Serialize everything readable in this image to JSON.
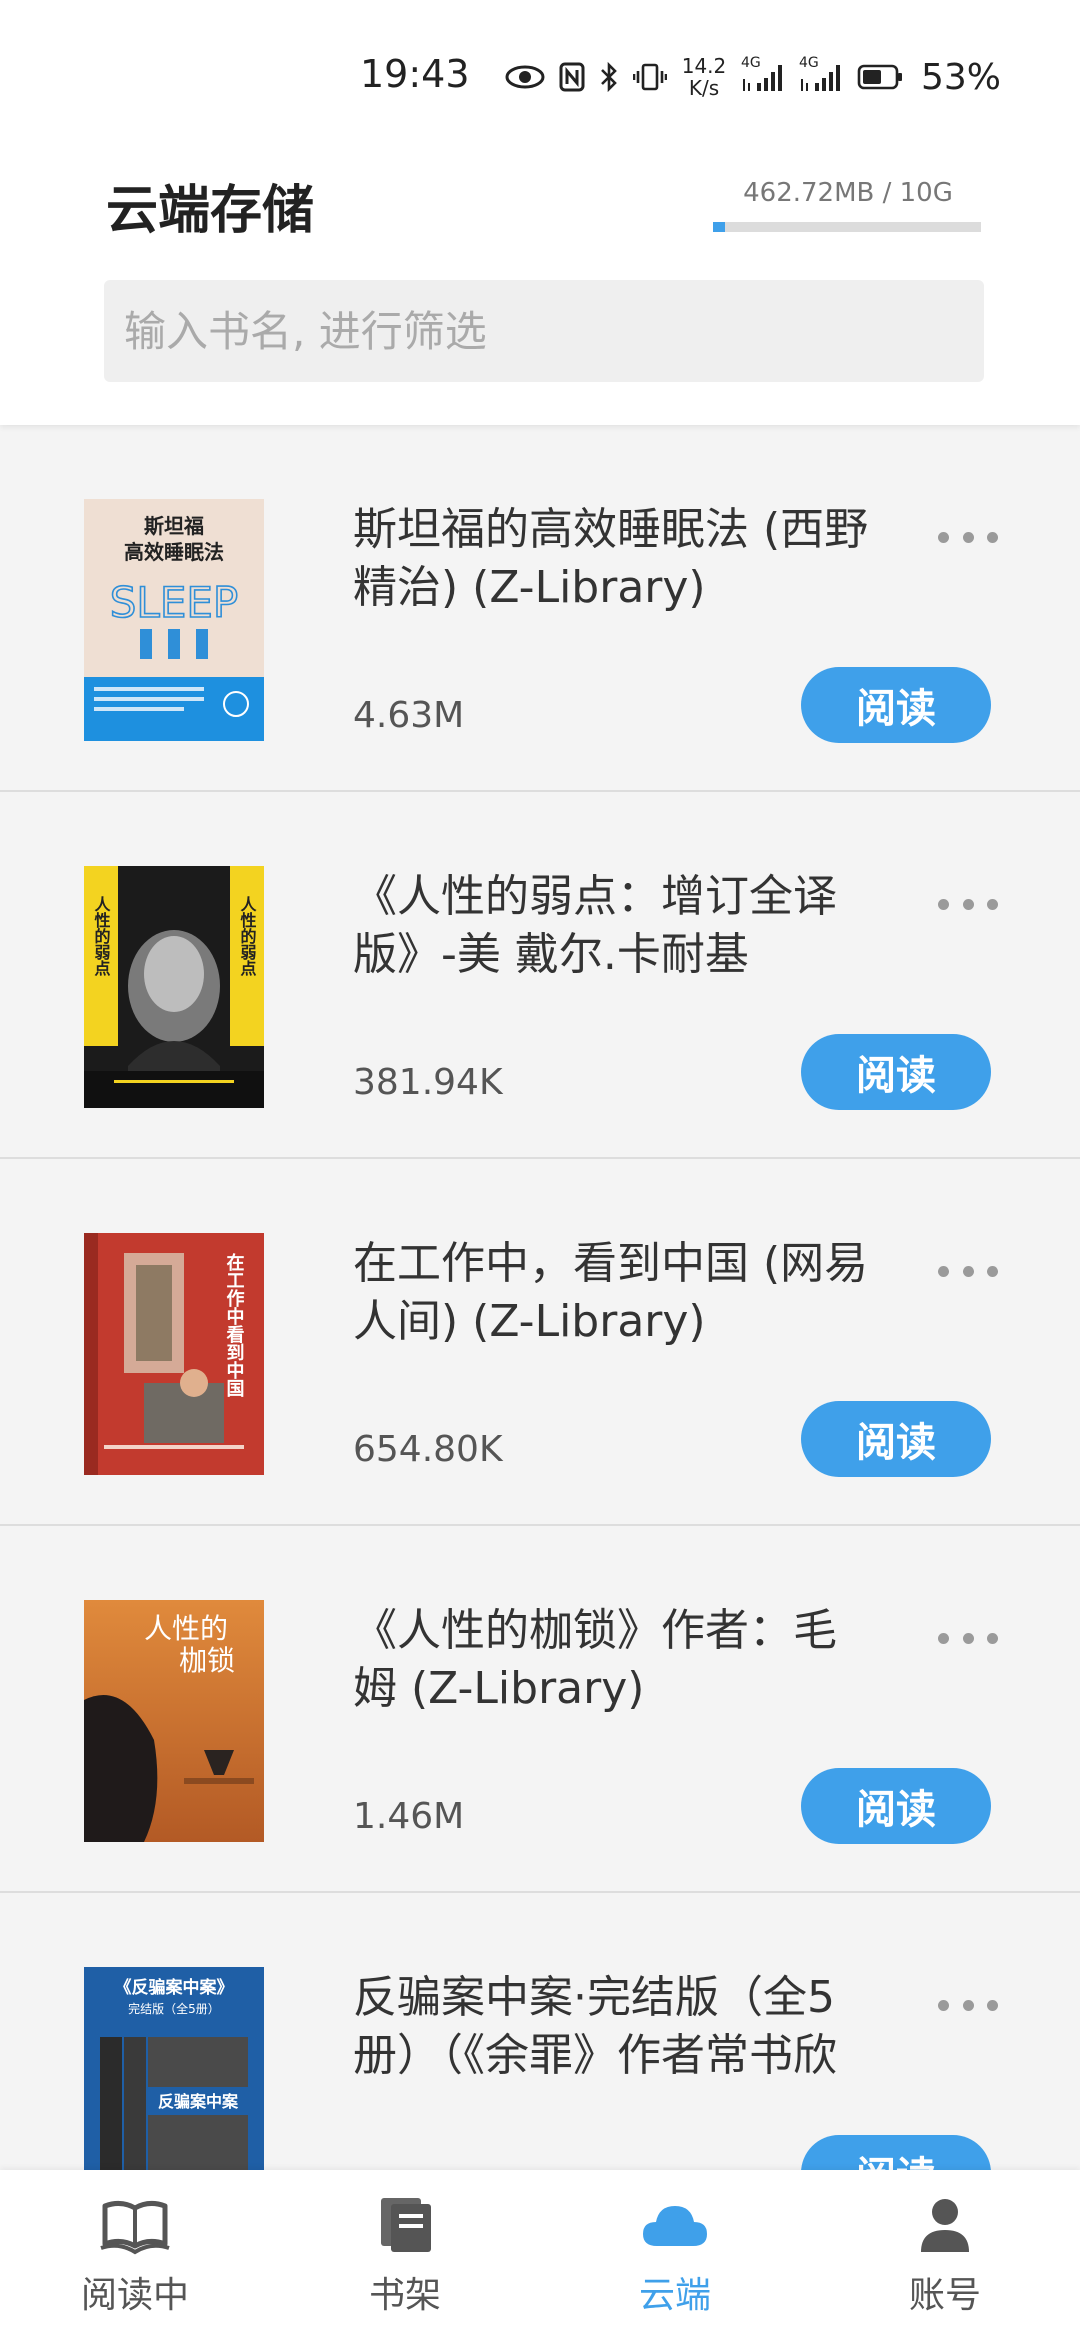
{
  "status_bar": {
    "time": "19:43",
    "net_speed_top": "14.2",
    "net_speed_bottom": "K/s",
    "signal1_label": "4G",
    "signal2_label": "4G",
    "battery_percent": "53%"
  },
  "header": {
    "title": "云端存储",
    "storage_text": "462.72MB / 10G",
    "storage_used_fraction": 0.045,
    "search_placeholder": "输入书名, 进行筛选"
  },
  "books": [
    {
      "title": "斯坦福的高效睡眠法 (西野精治) (Z-Library)",
      "size": "4.63M",
      "read_label": "阅读"
    },
    {
      "title": "《人性的弱点：增订全译版》-美 戴尔.卡耐基",
      "size": "381.94K",
      "read_label": "阅读"
    },
    {
      "title": "在工作中，看到中国 (网易人间) (Z-Library)",
      "size": "654.80K",
      "read_label": "阅读"
    },
    {
      "title": "《人性的枷锁》作者：毛姆 (Z-Library)",
      "size": "1.46M",
      "read_label": "阅读"
    },
    {
      "title": "反骗案中案·完结版（全5册）（《余罪》作者常书欣",
      "size": "",
      "read_label": "阅读"
    }
  ],
  "covers": {
    "book1_line1": "斯坦福",
    "book1_line2": "高效睡眠法",
    "book1_big": "SLEEP",
    "book2_side": "人性的弱点",
    "book3_side": "在工作中看到中国",
    "book4_line1": "人性的",
    "book4_line2": "枷锁",
    "book5_top": "《反骗案中案》",
    "book5_sub": "完结版（全5册）",
    "book5_center": "反骗案中案"
  },
  "nav": [
    {
      "label": "阅读中",
      "icon": "open-book-icon",
      "active": false
    },
    {
      "label": "书架",
      "icon": "bookshelf-icon",
      "active": false
    },
    {
      "label": "云端",
      "icon": "cloud-icon",
      "active": true
    },
    {
      "label": "账号",
      "icon": "person-icon",
      "active": false
    }
  ],
  "colors": {
    "accent": "#3fa0ea",
    "background": "#f4f4f4",
    "header_bg": "#ffffff"
  }
}
